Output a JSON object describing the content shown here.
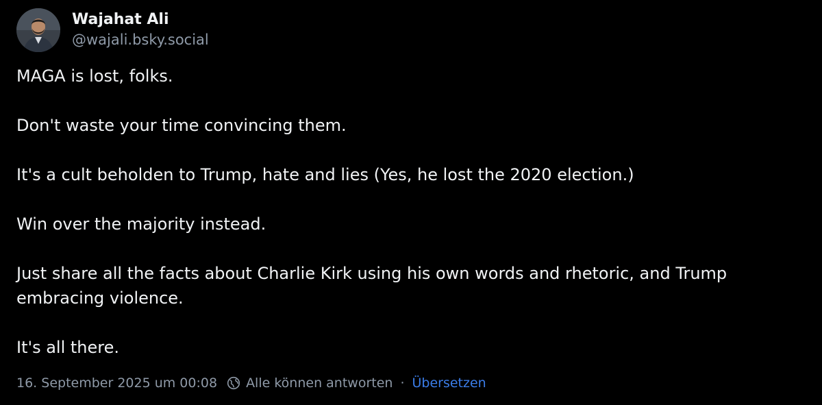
{
  "author": {
    "display_name": "Wajahat Ali",
    "handle": "@wajali.bsky.social"
  },
  "post": {
    "paragraphs": [
      "MAGA is lost, folks.",
      "Don't waste your time convincing them.",
      "It's a cult beholden to Trump, hate and lies (Yes, he lost the 2020 election.)",
      "Win over the majority instead.",
      "Just share all the facts about Charlie Kirk using his own words and rhetoric, and Trump embracing violence.",
      "It's all there."
    ]
  },
  "meta": {
    "timestamp": "16. September 2025 um 00:08",
    "reply_setting": "Alle können antworten",
    "separator": "·",
    "translate_label": "Übersetzen"
  },
  "colors": {
    "background": "#000000",
    "text": "#f1f3f5",
    "muted": "#8f9aa8",
    "link": "#3b7de9"
  },
  "icons": {
    "reply_setting": "globe-icon"
  }
}
